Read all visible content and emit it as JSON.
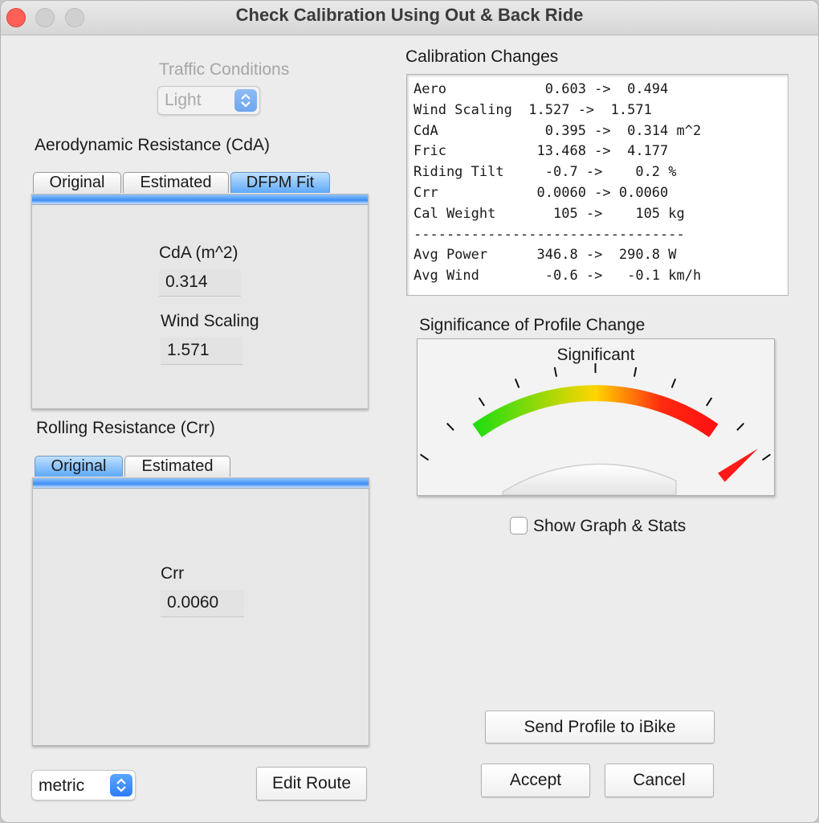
{
  "window": {
    "title": "Check Calibration Using Out & Back Ride"
  },
  "traffic": {
    "label": "Traffic Conditions",
    "value": "Light"
  },
  "aero": {
    "heading": "Aerodynamic Resistance (CdA)",
    "tabs": [
      "Original",
      "Estimated",
      "DFPM Fit"
    ],
    "active_tab": "DFPM Fit",
    "cda_label": "CdA (m^2)",
    "cda_value": "0.314",
    "wind_label": "Wind Scaling",
    "wind_value": "1.571"
  },
  "rolling": {
    "heading": "Rolling Resistance (Crr)",
    "tabs": [
      "Original",
      "Estimated"
    ],
    "active_tab": "Original",
    "crr_label": "Crr",
    "crr_value": "0.0060"
  },
  "calibration": {
    "heading": "Calibration Changes",
    "rows": [
      "Aero            0.603 ->  0.494",
      "Wind Scaling  1.527 ->  1.571",
      "CdA             0.395 ->  0.314 m^2",
      "Fric           13.468 ->  4.177",
      "Riding Tilt     -0.7 ->    0.2 %",
      "Crr            0.0060 -> 0.0060",
      "Cal Weight       105 ->    105 kg",
      "---------------------------------",
      "Avg Power      346.8 ->  290.8 W",
      "Avg Wind        -0.6 ->   -0.1 km/h"
    ]
  },
  "significance": {
    "heading": "Significance of Profile Change",
    "status": "Significant",
    "needle_level": 0.97,
    "colors": {
      "low": "#22dd11",
      "mid": "#ffd500",
      "high": "#ff1111"
    }
  },
  "show_graph": {
    "label": "Show Graph & Stats",
    "checked": false
  },
  "buttons": {
    "send": "Send Profile to iBike",
    "accept": "Accept",
    "cancel": "Cancel",
    "edit_route": "Edit Route"
  },
  "units": {
    "value": "metric"
  }
}
